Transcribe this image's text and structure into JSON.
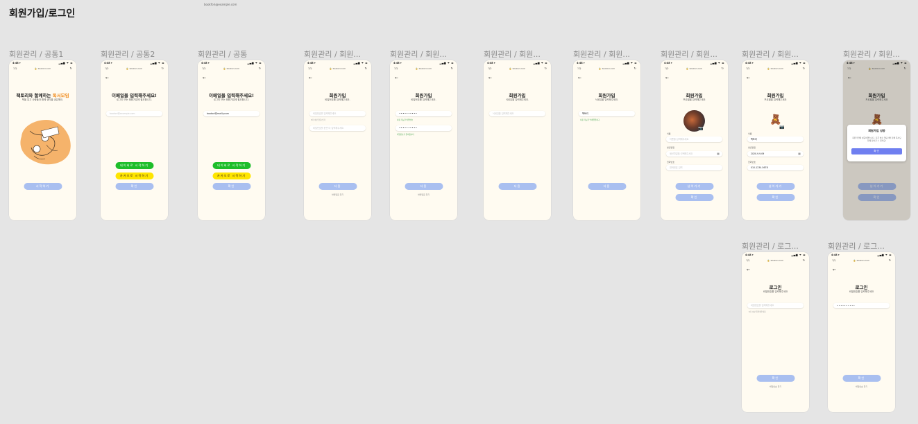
{
  "page": {
    "title": "회원가입/로그인",
    "note": "bookfori@example.com"
  },
  "phone": {
    "time": "4:48 ▾",
    "signal": "▂▄▆ ᯤ ▬",
    "browser": "가가",
    "url": "🔒 bookori.com",
    "reload": "↻",
    "back": "←"
  },
  "labels": [
    "회원관리 / 공통1",
    "회원관리 / 공통2",
    "회원관리 / 공통",
    "회원관리 / 회원...",
    "회원관리 / 회원...",
    "회원관리 / 회원...",
    "회원관리 / 회원...",
    "회원관리 / 회원...",
    "회원관리 / 회원...",
    "회원관리 / 회원...",
    "회원관리 / 로그...",
    "회원관리 / 로그..."
  ],
  "s1": {
    "title_a": "책토리와 함께하는 ",
    "title_b": "독서모임",
    "sub": "책을 읽고 사람들과 함께 생각을 공유해요.",
    "button": "시작하기"
  },
  "s2": {
    "title": "이메일을 입력해주세요!",
    "sub": "로그인 또는 회원가입에 필요합니다.",
    "placeholder": "bookori@example.com",
    "naver": "네이버로 시작하기",
    "kakao": "카카오로 시작하기",
    "confirm": "확인"
  },
  "s3": {
    "title": "이메일을 입력해주세요!",
    "sub": "로그인 또는 회원가입에 필요합니다.",
    "value": "bookori@mailly.com",
    "naver": "네이버로 시작하기",
    "kakao": "카카오로 시작하기",
    "confirm": "확인"
  },
  "s4": {
    "title": "회원가입",
    "sub": "비밀번호를 입력해주세요.",
    "pw_placeholder": "비밀번호를 입력해주세요",
    "hint": "8자 이상 영문/숫자",
    "pw2_placeholder": "비밀번호를 한번 더 입력해주세요",
    "next": "다음",
    "link": "이메일로 찾기"
  },
  "s5": {
    "title": "회원가입",
    "sub": "비밀번호를 입력해주세요.",
    "pw": "••••••••••",
    "hint_ok": "사용 가능한 비밀번호",
    "pw2": "••••••••••",
    "hint_err": "비밀번호가 일치합니다",
    "next": "다음",
    "link": "이메일로 찾기"
  },
  "s6": {
    "title": "회원가입",
    "sub": "닉네임을 입력해주세요.",
    "placeholder": "닉네임을 입력해주세요",
    "next": "다음"
  },
  "s7": {
    "title": "회원가입",
    "sub": "닉네임을 입력해주세요.",
    "value": "책토리",
    "hint_ok": "사용 가능한 닉네임입니다.",
    "next": "다음"
  },
  "s8": {
    "title": "회원가입",
    "sub": "프로필을 입력해주세요",
    "name_label": "이름",
    "name_placeholder": "이름을 입력해주세요",
    "birth_label": "생년월일",
    "birth_placeholder": "생년월일을 선택해주세요",
    "phone_label": "전화번호",
    "phone_placeholder": "전화번호 입력",
    "skip": "넘어가기",
    "confirm": "확인"
  },
  "s9": {
    "title": "회원가입",
    "sub": "프로필을 입력해주세요",
    "name_label": "이름",
    "name_value": "책토리",
    "birth_label": "생년월일",
    "birth_value": "2020.9.9.09",
    "phone_label": "전화번호",
    "phone_value": "010-1234-5678",
    "skip": "넘어가기",
    "confirm": "확인"
  },
  "s10": {
    "title": "회원가입",
    "sub": "프로필을 입력해주세요",
    "modal_title": "회원가입 성공",
    "modal_body": "회원가입에 성공하였습니다. 지금 바로 책토리와 함께 독서모임에 참여할 수 있어요!",
    "modal_button": "확인",
    "skip": "넘어가기",
    "confirm": "확인"
  },
  "s11": {
    "title": "로그인",
    "sub": "비밀번호를 입력해주세요",
    "placeholder": "비밀번호를 입력해주세요",
    "hint": "8자 이상 입력해주세요",
    "confirm": "확인",
    "link": "비밀번호 찾기"
  },
  "s12": {
    "title": "로그인",
    "sub": "비밀번호를 입력해주세요",
    "pw": "••••••••••",
    "confirm": "확인",
    "link": "비밀번호 찾기"
  }
}
